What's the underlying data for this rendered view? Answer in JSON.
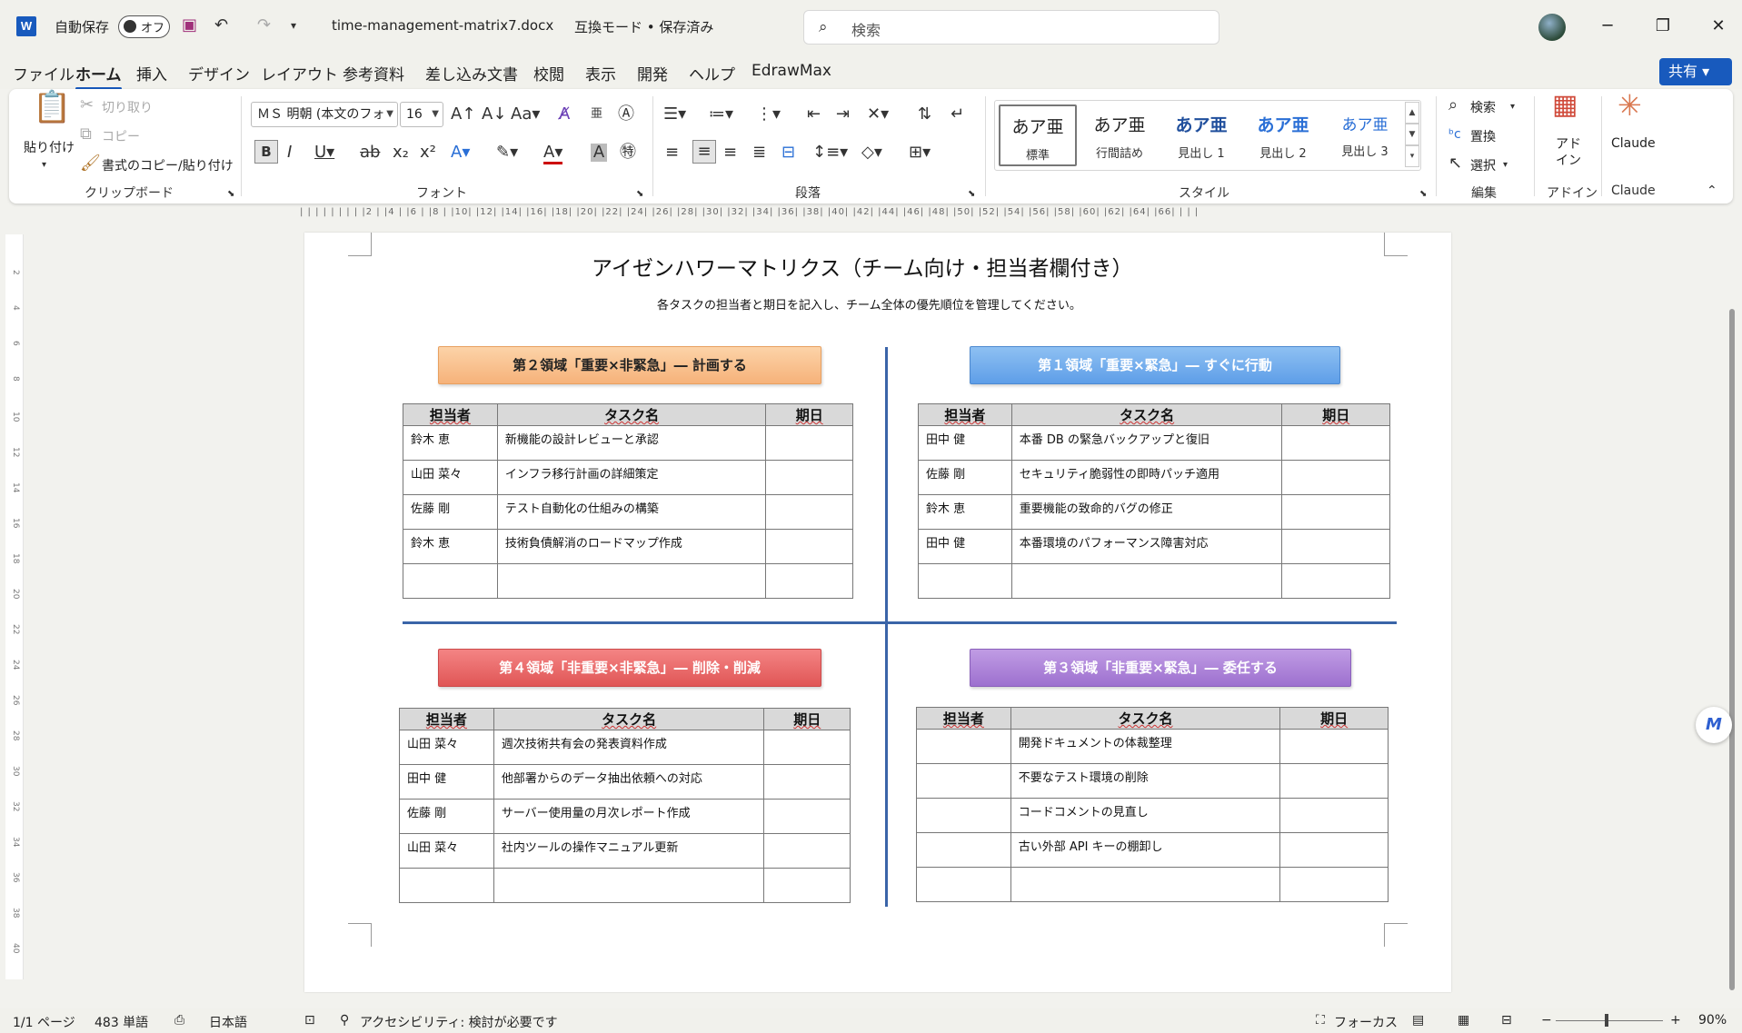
{
  "titlebar": {
    "app_icon": "W",
    "autosave_label": "自動保存",
    "autosave_state": "オフ",
    "filename": "time-management-matrix7.docx",
    "mode": "互換モード • 保存済み",
    "search_placeholder": "検索",
    "minimize": "─",
    "restore": "❐",
    "close": "✕"
  },
  "menu": {
    "tabs": [
      "ファイル",
      "ホーム",
      "挿入",
      "デザイン",
      "レイアウト",
      "参考資料",
      "差し込み文書",
      "校閲",
      "表示",
      "開発",
      "ヘルプ",
      "EdrawMax"
    ],
    "active": "ホーム",
    "share_label": "共有"
  },
  "ribbon": {
    "clipboard": {
      "paste": "貼り付け",
      "cut": "切り取り",
      "copy": "コピー",
      "format_painter": "書式のコピー/貼り付け",
      "label": "クリップボード"
    },
    "font": {
      "name": "ＭＳ 明朝 (本文のフォ",
      "size": "16",
      "label": "フォント"
    },
    "paragraph": {
      "label": "段落"
    },
    "styles": {
      "items": [
        {
          "preview": "あア亜",
          "name": "標準"
        },
        {
          "preview": "あア亜",
          "name": "行間詰め"
        },
        {
          "preview": "あア亜",
          "name": "見出し 1"
        },
        {
          "preview": "あア亜",
          "name": "見出し 2"
        },
        {
          "preview": "あア亜",
          "name": "見出し 3"
        }
      ],
      "label": "スタイル"
    },
    "editing": {
      "find": "検索",
      "replace": "置換",
      "select": "選択",
      "label": "編集"
    },
    "addins": {
      "button": "アド\nイン",
      "label": "アドイン"
    },
    "claude": {
      "button": "Claude",
      "label": "Claude"
    }
  },
  "document": {
    "title": "アイゼンハワーマトリクス（チーム向け・担当者欄付き）",
    "subtitle": "各タスクの担当者と期日を記入し、チーム全体の優先順位を管理してください。",
    "headers": {
      "owner": "担当者",
      "task": "タスク名",
      "due": "期日"
    },
    "quadrants": {
      "q2": {
        "title": "第２領域「重要×非緊急」― 計画する",
        "rows": [
          {
            "owner": "鈴木 恵",
            "task": "新機能の設計レビューと承認",
            "due": ""
          },
          {
            "owner": "山田 菜々",
            "task": "インフラ移行計画の詳細策定",
            "due": ""
          },
          {
            "owner": "佐藤 剛",
            "task": "テスト自動化の仕組みの構築",
            "due": ""
          },
          {
            "owner": "鈴木 恵",
            "task": "技術負債解消のロードマップ作成",
            "due": ""
          },
          {
            "owner": "",
            "task": "",
            "due": ""
          }
        ]
      },
      "q1": {
        "title": "第１領域「重要×緊急」― すぐに行動",
        "rows": [
          {
            "owner": "田中 健",
            "task": "本番 DB の緊急バックアップと復旧",
            "due": ""
          },
          {
            "owner": "佐藤 剛",
            "task": "セキュリティ脆弱性の即時パッチ適用",
            "due": ""
          },
          {
            "owner": "鈴木 恵",
            "task": "重要機能の致命的バグの修正",
            "due": ""
          },
          {
            "owner": "田中 健",
            "task": "本番環境のパフォーマンス障害対応",
            "due": ""
          },
          {
            "owner": "",
            "task": "",
            "due": ""
          }
        ]
      },
      "q4": {
        "title": "第４領域「非重要×非緊急」― 削除・削減",
        "rows": [
          {
            "owner": "山田 菜々",
            "task": "週次技術共有会の発表資料作成",
            "due": ""
          },
          {
            "owner": "田中 健",
            "task": "他部署からのデータ抽出依頼への対応",
            "due": ""
          },
          {
            "owner": "佐藤 剛",
            "task": "サーバー使用量の月次レポート作成",
            "due": ""
          },
          {
            "owner": "山田 菜々",
            "task": "社内ツールの操作マニュアル更新",
            "due": ""
          },
          {
            "owner": "",
            "task": "",
            "due": ""
          }
        ]
      },
      "q3": {
        "title": "第３領域「非重要×緊急」― 委任する",
        "rows": [
          {
            "owner": "",
            "task": "開発ドキュメントの体裁整理",
            "due": ""
          },
          {
            "owner": "",
            "task": "不要なテスト環境の削除",
            "due": ""
          },
          {
            "owner": "",
            "task": "コードコメントの見直し",
            "due": ""
          },
          {
            "owner": "",
            "task": "古い外部 API キーの棚卸し",
            "due": ""
          },
          {
            "owner": "",
            "task": "",
            "due": ""
          }
        ]
      }
    }
  },
  "statusbar": {
    "page": "1/1 ページ",
    "words": "483 単語",
    "language": "日本語",
    "accessibility": "アクセシビリティ: 検討が必要です",
    "focus": "フォーカス",
    "zoom": "90%"
  },
  "colors": {
    "accent": "#185abd",
    "q1": "#5e9ee8",
    "q2": "#f6b27a",
    "q3": "#9d70cf",
    "q4": "#e05656",
    "divider": "#3a64a8"
  }
}
